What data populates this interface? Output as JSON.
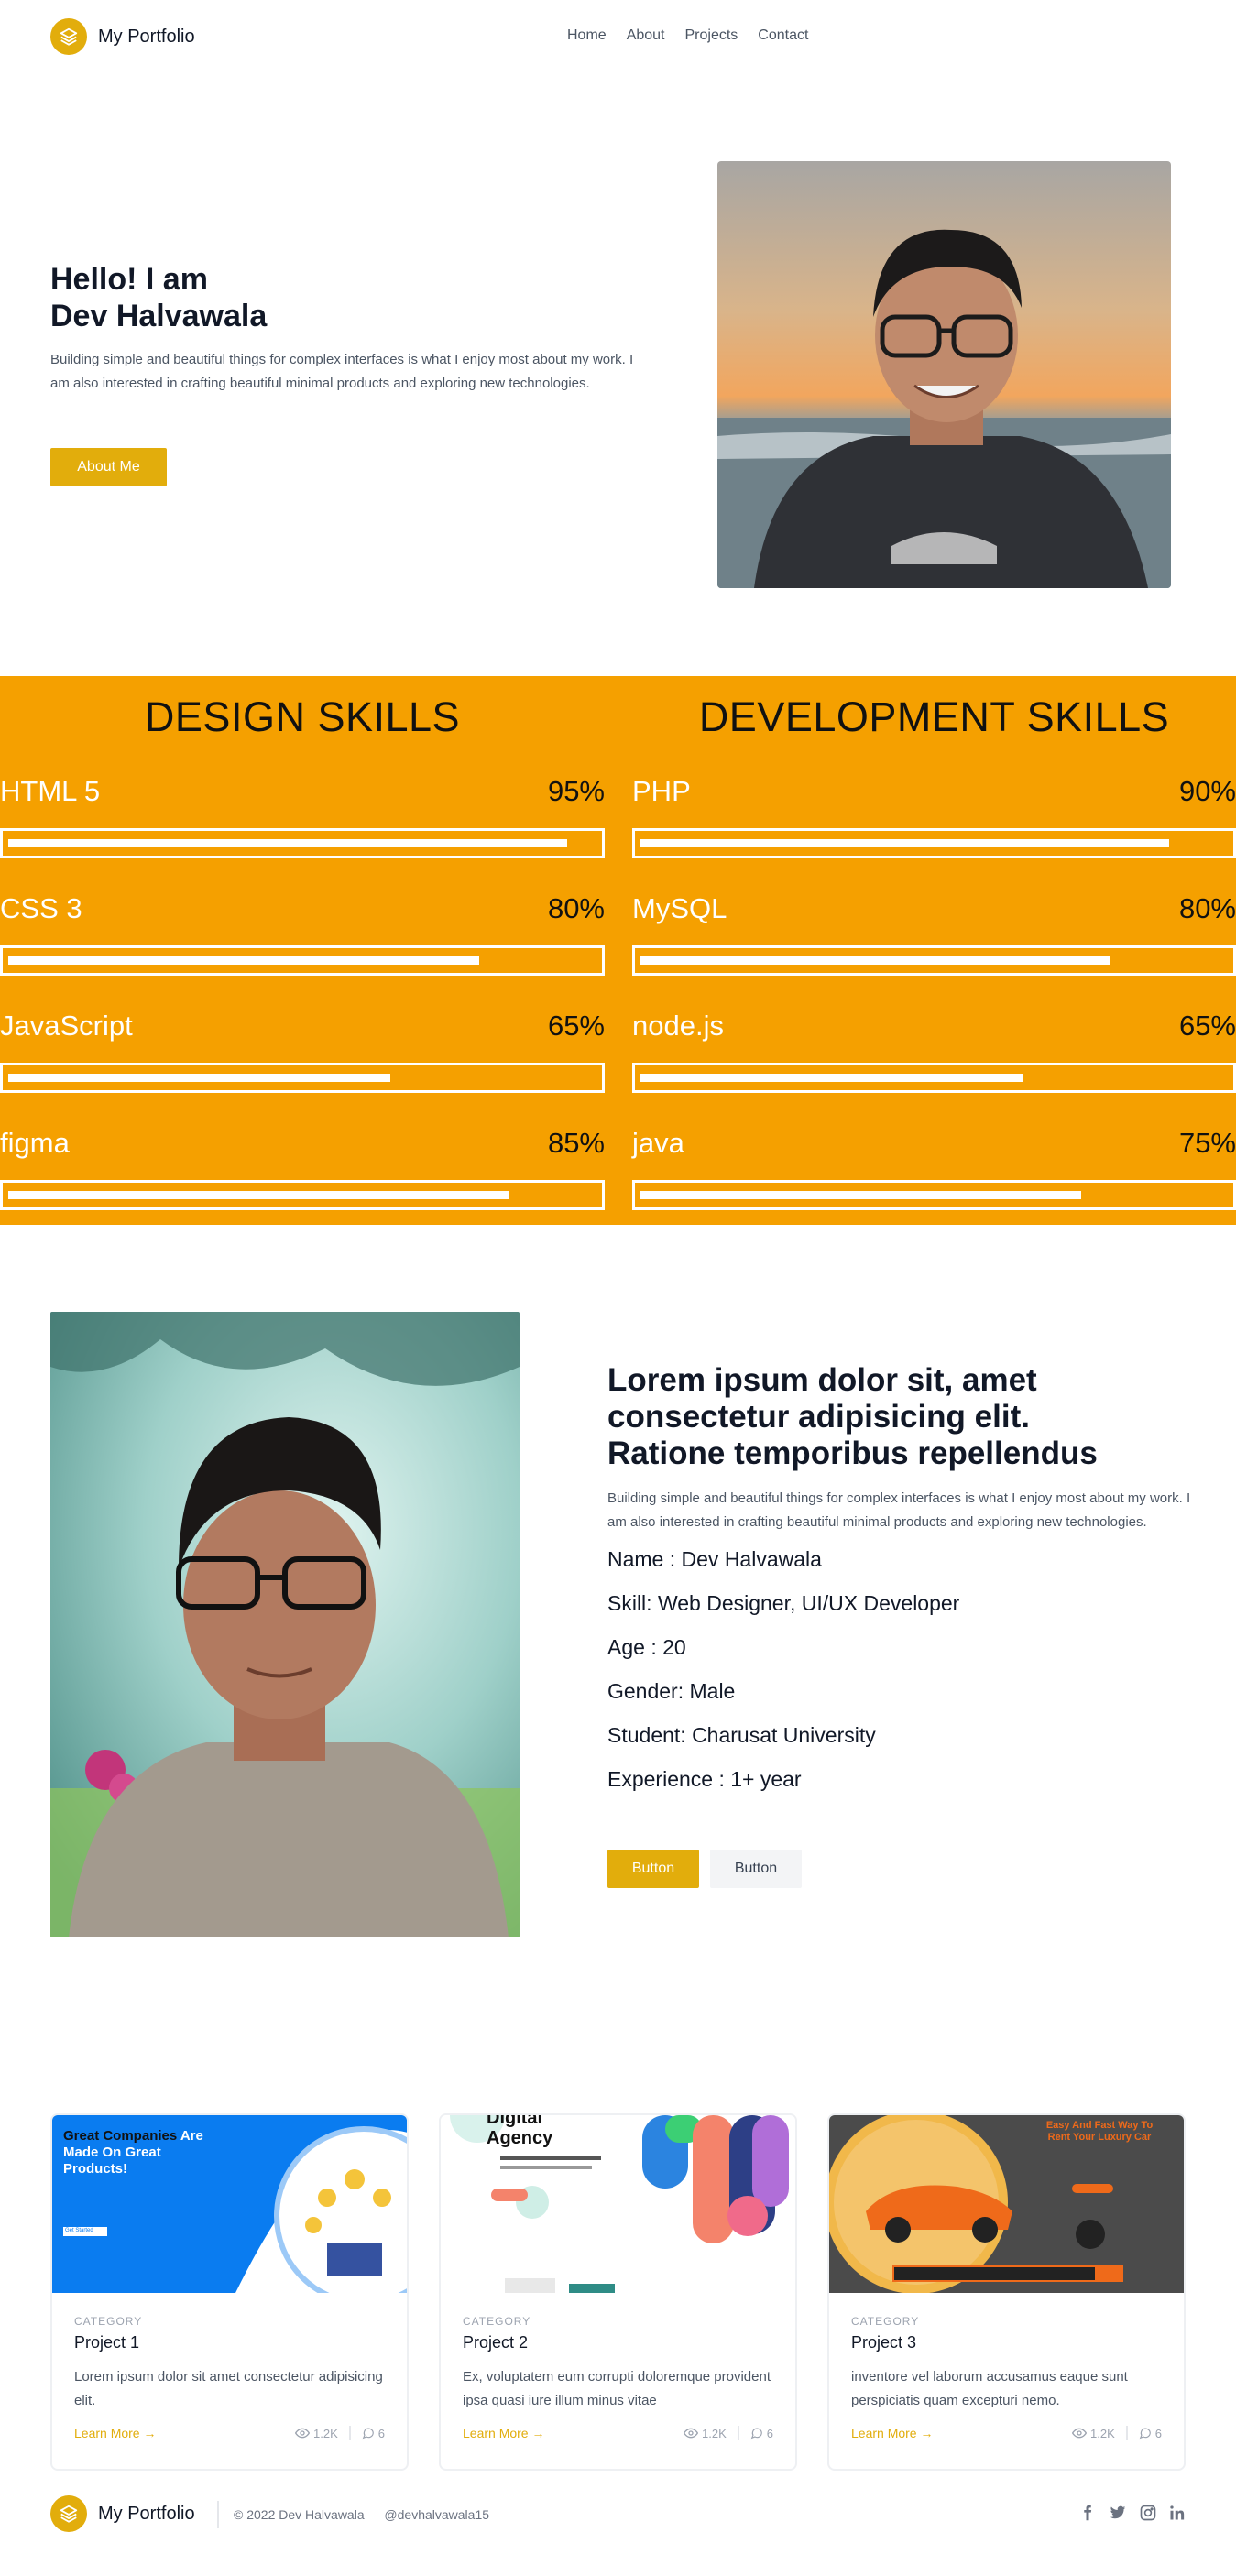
{
  "header": {
    "logo_text": "My Portfolio",
    "nav": [
      "Home",
      "About",
      "Projects",
      "Contact"
    ]
  },
  "hero": {
    "title_line1": "Hello! I am",
    "title_line2": "Dev Halvawala",
    "description": "Building simple and beautiful things for complex interfaces is what I enjoy most about my work. I am also interested in crafting beautiful minimal products and exploring new technologies.",
    "button": "About Me",
    "photo_alt": "portrait-beach-sunset"
  },
  "skills": {
    "design": {
      "heading": "DESIGN SKILLS",
      "items": [
        {
          "name": "HTML 5",
          "percent": "95%",
          "level": 0.95
        },
        {
          "name": "CSS 3",
          "percent": "80%",
          "level": 0.8
        },
        {
          "name": "JavaScript",
          "percent": "65%",
          "level": 0.65
        },
        {
          "name": "figma",
          "percent": "85%",
          "level": 0.85
        }
      ]
    },
    "development": {
      "heading": "DEVELOPMENT SKILLS",
      "items": [
        {
          "name": "PHP",
          "percent": "90%",
          "level": 0.9
        },
        {
          "name": "MySQL",
          "percent": "80%",
          "level": 0.8
        },
        {
          "name": "node.js",
          "percent": "65%",
          "level": 0.65
        },
        {
          "name": "java",
          "percent": "75%",
          "level": 0.75
        }
      ]
    }
  },
  "about": {
    "title_line1": "Lorem ipsum dolor sit, amet",
    "title_line2": "consectetur adipisicing elit.",
    "title_line3": "Ratione temporibus repellendus",
    "description": "Building simple and beautiful things for complex interfaces is what I enjoy most about my work. I am also interested in crafting beautiful minimal products and exploring new technologies.",
    "facts": [
      "Name : Dev Halvawala",
      "Skill: Web Designer, UI/UX Developer",
      "Age : 20",
      "Gender: Male",
      "Student: Charusat University",
      "Experience : 1+ year"
    ],
    "button_primary": "Button",
    "button_secondary": "Button"
  },
  "projects": [
    {
      "category": "CATEGORY",
      "title": "Project 1",
      "description": "Lorem ipsum dolor sit amet consectetur adipisicing elit.",
      "learn_more": "Learn More",
      "views": "1.2K",
      "comments": "6",
      "thumb": {
        "headline_a": "Great Companies",
        "headline_b": "Are",
        "headline_c": "Made On Great",
        "headline_d": "Products!",
        "cta": "Get Started"
      }
    },
    {
      "category": "CATEGORY",
      "title": "Project 2",
      "description": "Ex, voluptatem eum corrupti doloremque provident ipsa quasi iure illum minus vitae",
      "learn_more": "Learn More",
      "views": "1.2K",
      "comments": "6",
      "thumb": {
        "headline_a": "Digital",
        "headline_b": "Agency"
      }
    },
    {
      "category": "CATEGORY",
      "title": "Project 3",
      "description": "inventore vel laborum accusamus eaque sunt perspiciatis quam excepturi nemo.",
      "learn_more": "Learn More",
      "views": "1.2K",
      "comments": "6",
      "thumb": {
        "headline_a": "Easy And Fast Way To",
        "headline_b": "Rent Your Luxury Car"
      }
    }
  ],
  "footer": {
    "logo_text": "My Portfolio",
    "copyright": "© 2022 Dev Halvawala —",
    "handle": "@devhalvawala15",
    "social": [
      "facebook-icon",
      "twitter-icon",
      "instagram-icon",
      "linkedin-icon"
    ]
  },
  "colors": {
    "accent": "#e2ad0c",
    "skills_bg": "#f5a000",
    "text_dark": "#111827",
    "text_muted": "#4b5563"
  }
}
